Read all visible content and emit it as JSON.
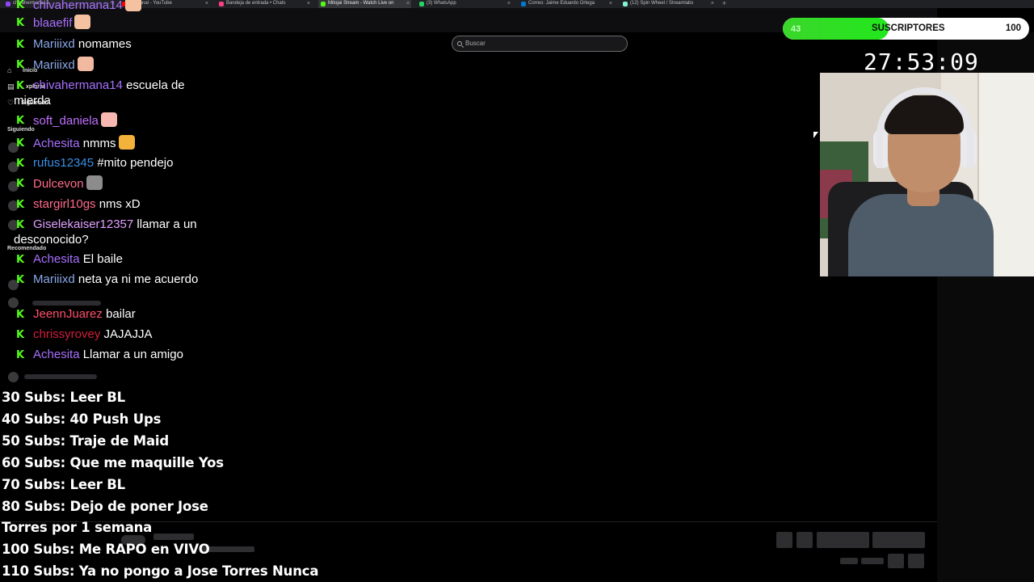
{
  "browser": {
    "tabs": [
      {
        "label": "chivahermana14",
        "color": "#9146ff"
      },
      {
        "label": "del canal - YouTube",
        "color": "#ff0000"
      },
      {
        "label": "Bandeja de entrada • Chats",
        "color": "#ff4081"
      },
      {
        "label": "Mitojai Stream - Watch Live on",
        "color": "#53fc18"
      },
      {
        "label": "(3) WhatsApp",
        "color": "#25d366"
      },
      {
        "label": "Correo: Jaime Eduardo Ortega",
        "color": "#0078d4"
      },
      {
        "label": "(12) Spin Wheel / Streamlabs",
        "color": "#80f5d2"
      }
    ],
    "new_tab": "+"
  },
  "page": {
    "search_placeholder": "Buscar",
    "nav": {
      "inicio": "Inicio",
      "explorar": "xplorar",
      "siguiendo_menu": "Siguiendo",
      "siguiendo_header": "Siguiendo",
      "recomendado_header": "Recomendado"
    }
  },
  "chat": {
    "messages": [
      {
        "user": "chivahermana14",
        "color": "#a970ff",
        "text": "",
        "emote": "#f4c2a0"
      },
      {
        "user": "blaaefif",
        "color": "#a970ff",
        "text": "",
        "emote": "#f4c2a0"
      },
      {
        "user": "Mariiixd",
        "color": "#8aa8e8",
        "text": "nomames",
        "emote": ""
      },
      {
        "user": "Mariiixd",
        "color": "#8aa8e8",
        "text": "",
        "emote": "#f1b9a0"
      },
      {
        "user": "chivahermana14",
        "color": "#a970ff",
        "text": "escuela de mierda",
        "emote": ""
      },
      {
        "user": "soft_daniela",
        "color": "#c070ff",
        "text": "",
        "emote": "#f6b8b0"
      },
      {
        "user": "Achesita",
        "color": "#a970ff",
        "text": "nmms",
        "emote": "#f3b23a"
      },
      {
        "user": "rufus12345",
        "color": "#3a8ee6",
        "text": "#mito pendejo",
        "emote": ""
      },
      {
        "user": "Dulcevon",
        "color": "#ff6b8a",
        "text": "",
        "emote": "#8c8c8c"
      },
      {
        "user": "stargirl10gs",
        "color": "#ff6b8a",
        "text": "nms xD",
        "emote": ""
      },
      {
        "user": "Giselekaiser12357",
        "color": "#e0a0ff",
        "text": "llamar a un desconocido?",
        "emote": ""
      },
      {
        "user": "Achesita",
        "color": "#a970ff",
        "text": "El baile",
        "emote": ""
      },
      {
        "user": "Mariiixd",
        "color": "#8aa8e8",
        "text": "neta ya ni me acuerdo",
        "emote": ""
      },
      {
        "user": "JeennJuarez",
        "color": "#ff4f6a",
        "text": "bailar",
        "emote": ""
      },
      {
        "user": "chrissyrovey",
        "color": "#d11d3a",
        "text": "JAJAJJA",
        "emote": ""
      },
      {
        "user": "Achesita",
        "color": "#a970ff",
        "text": "Llamar a un amigo",
        "emote": ""
      }
    ]
  },
  "goals": [
    "30 Subs: Leer BL",
    "40 Subs: 40 Push Ups",
    "50 Subs: Traje de Maid",
    "60 Subs: Que me maquille Yos",
    "70 Subs: Leer BL",
    "80 Subs: Dejo de poner Jose",
    "Torres por 1 semana",
    "100 Subs: Me RAPO en VIVO",
    "110 Subs: Ya no pongo a Jose Torres Nunca"
  ],
  "subs": {
    "current": "43",
    "label": "SUSCRIPTORES",
    "goal": "100",
    "progress": 0.43
  },
  "timer": "27:53:09"
}
